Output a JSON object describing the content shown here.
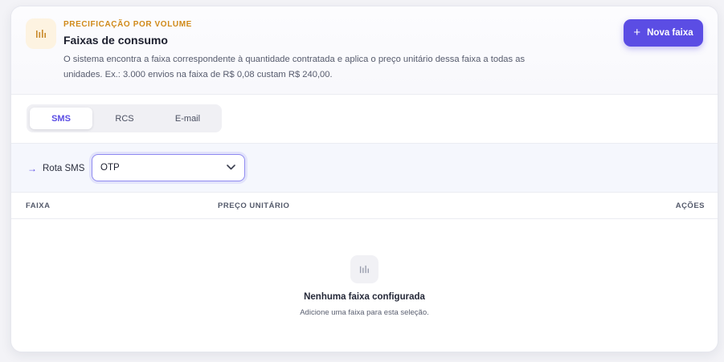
{
  "header": {
    "icon": "bar-chart-icon",
    "eyebrow": "PRECIFICAÇÃO POR VOLUME",
    "title": "Faixas de consumo",
    "description": "O sistema encontra a faixa correspondente à quantidade contratada e aplica o preço unitário dessa faixa a todas as unidades. Ex.: 3.000 envios na faixa de R$ 0,08 custam R$ 240,00.",
    "new_button": {
      "icon": "plus-icon",
      "label": "Nova faixa"
    }
  },
  "tabs": [
    {
      "label": "SMS",
      "active": true
    },
    {
      "label": "RCS",
      "active": false
    },
    {
      "label": "E-mail",
      "active": false
    }
  ],
  "route": {
    "icon": "arrow-right-icon",
    "label": "Rota SMS",
    "selected": "OTP"
  },
  "table": {
    "columns": [
      "FAIXA",
      "PREÇO UNITÁRIO",
      "AÇÕES"
    ]
  },
  "empty_state": {
    "icon": "bar-chart-icon",
    "title": "Nenhuma faixa configurada",
    "subtitle": "Adicione uma faixa para esta seleção."
  },
  "colors": {
    "accent": "#5b4de4",
    "eyebrow": "#d08a1a",
    "icon_bg": "#fdf3e1"
  }
}
